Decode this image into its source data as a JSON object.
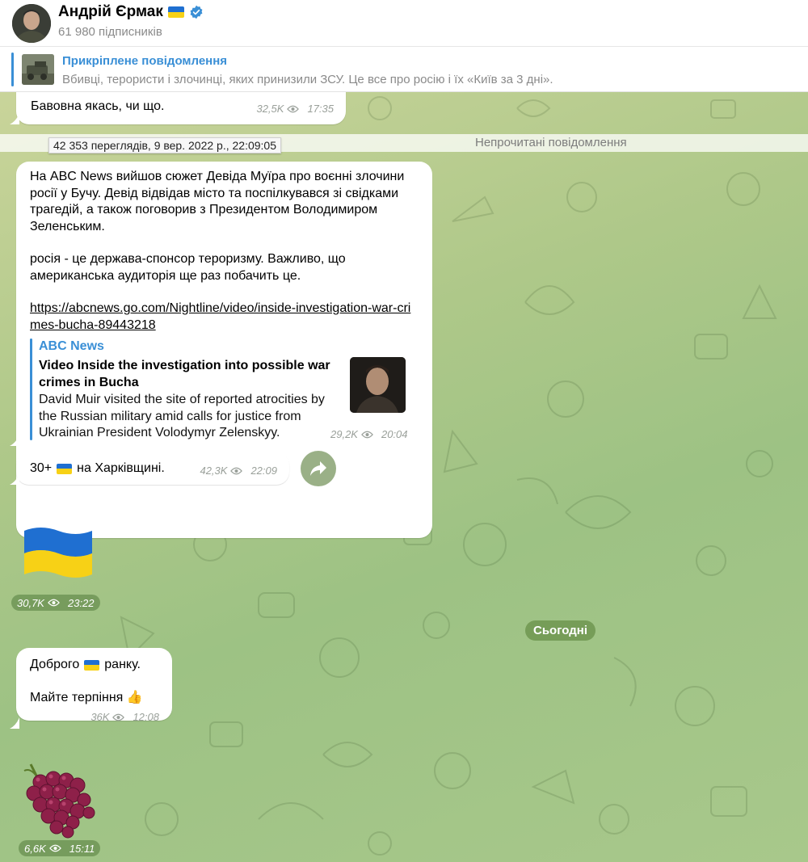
{
  "header": {
    "channel_name": "Андрій Єрмак",
    "subscribers": "61 980 підписників"
  },
  "pinned": {
    "title": "Прикріплене повідомлення",
    "text": "Вбивці, терористи і злочинці, яких принизили ЗСУ.   Це все про росію і їх «Київ за 3 дні»."
  },
  "messages": [
    {
      "text": "Бавовна якась, чи що.",
      "views": "32,5K",
      "time": "17:35"
    },
    {
      "paragraph1": "На ABC News вийшов сюжет Девіда Муїра про воєнні злочини росії у Бучу. Девід відвідав місто та поспілкувався зі свідками трагедій, а також поговорив з Президентом Володимиром Зеленським.",
      "paragraph2": "росія - це держава-спонсор тероризму. Важливо, що американська аудиторія ще раз побачить це.",
      "link": "https://abcnews.go.com/Nightline/video/inside-investigation-war-crimes-bucha-89443218",
      "preview": {
        "site": "ABC News",
        "title": "Video Inside the investigation into possible war crimes in Bucha",
        "description": "David Muir visited the site of reported atrocities by the Russian military amid calls for justice from Ukrainian President Volodymyr Zelenskyy."
      },
      "views": "29,2K",
      "time": "20:04"
    },
    {
      "text_before": "30+",
      "text_after": "на Харківщині.",
      "views": "42,3K",
      "time": "22:09"
    },
    {
      "sticker": "ukraine-flag",
      "views": "30,7K",
      "time": "23:22"
    },
    {
      "line1_before": "Доброго",
      "line1_after": "ранку.",
      "line2": "Майте терпіння 👍",
      "views": "36K",
      "time": "12:08"
    },
    {
      "sticker": "grapes",
      "views": "6,6K",
      "time": "15:11"
    }
  ],
  "tooltip": "42 353 переглядів, 9 вер. 2022 р., 22:09:05",
  "unread_label": "Непрочитані повідомлення",
  "date_divider": "Сьогодні",
  "colors": {
    "accent": "#3a8fd6",
    "link": "#2b76c8",
    "flag_blue": "#1f6fd1",
    "flag_yellow": "#f7d116"
  }
}
